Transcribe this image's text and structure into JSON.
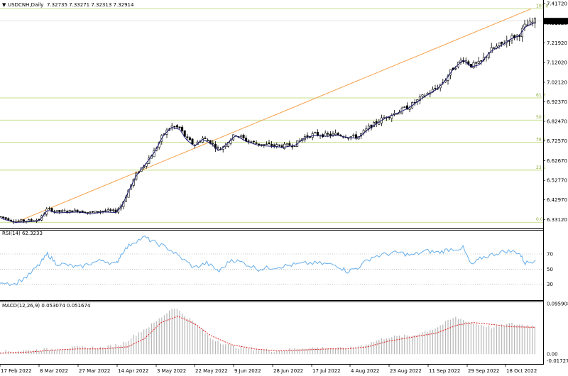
{
  "colors": {
    "candle": "#000000",
    "ma_line": "#1a1a6e",
    "trend_line": "#f5a04a",
    "fib_line": "#b5d46a",
    "rsi_line": "#66aeea",
    "macd_hist": "#b8b8b8",
    "macd_signal": "#e02020",
    "price_tag_bg": "#000000",
    "price_tag_text": "#ffffff"
  },
  "chart_data": [
    {
      "type": "candlestick",
      "panel": "price",
      "header": {
        "symbol": "USDCNH,Daily",
        "ohlc": "7.32735 7.33271 7.32313 7.32914",
        "arrow_icon": "triangle-down-icon"
      },
      "current_price_label": "7.32914",
      "y_ticks": [
        "7.41720",
        "7.31920",
        "7.21920",
        "7.12020",
        "7.02120",
        "6.92370",
        "6.82470",
        "6.72570",
        "6.62670",
        "6.52770",
        "6.42970",
        "6.33120"
      ],
      "ylim": [
        6.3,
        7.4172
      ],
      "x_ticks": [
        "17 Feb 2022",
        "8 Mar 2022",
        "27 Mar 2022",
        "14 Apr 2022",
        "3 May 2022",
        "22 May 2022",
        "9 Jun 2022",
        "28 Jun 2022",
        "17 Jul 2022",
        "4 Aug 2022",
        "23 Aug 2022",
        "11 Sep 2022",
        "29 Sep 2022",
        "18 Oct 2022"
      ],
      "fib_levels": [
        {
          "label": "100.0",
          "value": 7.3905
        },
        {
          "label": "61.8",
          "value": 6.9425
        },
        {
          "label": "50.0",
          "value": 6.831
        },
        {
          "label": "38.2",
          "value": 6.719
        },
        {
          "label": "23.6",
          "value": 6.579
        },
        {
          "label": "0.0",
          "value": 6.317
        }
      ],
      "trend_line": [
        {
          "x": "2022-02-25",
          "y": 6.318
        },
        {
          "x": "2022-11-01",
          "y": 7.391
        }
      ],
      "close_path": [
        [
          "2022-02-17",
          6.345
        ],
        [
          "2022-02-24",
          6.322
        ],
        [
          "2022-03-03",
          6.325
        ],
        [
          "2022-03-08",
          6.33
        ],
        [
          "2022-03-12",
          6.385
        ],
        [
          "2022-03-16",
          6.37
        ],
        [
          "2022-03-22",
          6.372
        ],
        [
          "2022-03-27",
          6.375
        ],
        [
          "2022-04-02",
          6.365
        ],
        [
          "2022-04-08",
          6.375
        ],
        [
          "2022-04-14",
          6.372
        ],
        [
          "2022-04-17",
          6.405
        ],
        [
          "2022-04-20",
          6.475
        ],
        [
          "2022-04-24",
          6.56
        ],
        [
          "2022-04-28",
          6.61
        ],
        [
          "2022-05-03",
          6.68
        ],
        [
          "2022-05-07",
          6.76
        ],
        [
          "2022-05-11",
          6.8
        ],
        [
          "2022-05-15",
          6.79
        ],
        [
          "2022-05-18",
          6.74
        ],
        [
          "2022-05-22",
          6.705
        ],
        [
          "2022-05-26",
          6.74
        ],
        [
          "2022-05-30",
          6.72
        ],
        [
          "2022-06-03",
          6.68
        ],
        [
          "2022-06-07",
          6.72
        ],
        [
          "2022-06-11",
          6.76
        ],
        [
          "2022-06-16",
          6.73
        ],
        [
          "2022-06-22",
          6.71
        ],
        [
          "2022-06-28",
          6.705
        ],
        [
          "2022-07-04",
          6.7
        ],
        [
          "2022-07-10",
          6.71
        ],
        [
          "2022-07-14",
          6.745
        ],
        [
          "2022-07-19",
          6.76
        ],
        [
          "2022-07-25",
          6.755
        ],
        [
          "2022-07-30",
          6.76
        ],
        [
          "2022-08-04",
          6.75
        ],
        [
          "2022-08-09",
          6.745
        ],
        [
          "2022-08-14",
          6.79
        ],
        [
          "2022-08-19",
          6.825
        ],
        [
          "2022-08-23",
          6.85
        ],
        [
          "2022-08-29",
          6.875
        ],
        [
          "2022-09-03",
          6.9
        ],
        [
          "2022-09-07",
          6.93
        ],
        [
          "2022-09-11",
          6.96
        ],
        [
          "2022-09-16",
          6.99
        ],
        [
          "2022-09-20",
          7.03
        ],
        [
          "2022-09-24",
          7.09
        ],
        [
          "2022-09-29",
          7.14
        ],
        [
          "2022-10-03",
          7.105
        ],
        [
          "2022-10-07",
          7.115
        ],
        [
          "2022-10-12",
          7.18
        ],
        [
          "2022-10-18",
          7.215
        ],
        [
          "2022-10-22",
          7.245
        ],
        [
          "2022-10-26",
          7.26
        ],
        [
          "2022-10-29",
          7.305
        ],
        [
          "2022-11-03",
          7.329
        ]
      ]
    },
    {
      "type": "line",
      "panel": "rsi",
      "title": "RSI(14) 62.3233",
      "y_ticks": [
        "70",
        "50",
        "30"
      ],
      "ylim": [
        10,
        100
      ],
      "values": [
        [
          "2022-02-17",
          34
        ],
        [
          "2022-02-24",
          30
        ],
        [
          "2022-03-03",
          42
        ],
        [
          "2022-03-08",
          56
        ],
        [
          "2022-03-12",
          70
        ],
        [
          "2022-03-16",
          58
        ],
        [
          "2022-03-22",
          55
        ],
        [
          "2022-03-27",
          52
        ],
        [
          "2022-04-02",
          58
        ],
        [
          "2022-04-08",
          62
        ],
        [
          "2022-04-14",
          56
        ],
        [
          "2022-04-17",
          72
        ],
        [
          "2022-04-22",
          85
        ],
        [
          "2022-04-28",
          92
        ],
        [
          "2022-05-03",
          85
        ],
        [
          "2022-05-09",
          78
        ],
        [
          "2022-05-15",
          66
        ],
        [
          "2022-05-22",
          52
        ],
        [
          "2022-05-28",
          58
        ],
        [
          "2022-06-03",
          47
        ],
        [
          "2022-06-09",
          63
        ],
        [
          "2022-06-15",
          58
        ],
        [
          "2022-06-22",
          50
        ],
        [
          "2022-06-28",
          52
        ],
        [
          "2022-07-04",
          54
        ],
        [
          "2022-07-10",
          56
        ],
        [
          "2022-07-17",
          58
        ],
        [
          "2022-07-24",
          57
        ],
        [
          "2022-07-30",
          55
        ],
        [
          "2022-08-04",
          47
        ],
        [
          "2022-08-09",
          52
        ],
        [
          "2022-08-16",
          66
        ],
        [
          "2022-08-23",
          70
        ],
        [
          "2022-08-29",
          72
        ],
        [
          "2022-09-04",
          68
        ],
        [
          "2022-09-11",
          74
        ],
        [
          "2022-09-17",
          72
        ],
        [
          "2022-09-22",
          76
        ],
        [
          "2022-09-29",
          78
        ],
        [
          "2022-10-03",
          55
        ],
        [
          "2022-10-08",
          65
        ],
        [
          "2022-10-14",
          70
        ],
        [
          "2022-10-20",
          74
        ],
        [
          "2022-10-26",
          72
        ],
        [
          "2022-10-29",
          58
        ],
        [
          "2022-11-03",
          62
        ]
      ]
    },
    {
      "type": "bar",
      "panel": "macd",
      "title": "MACD(12,26,9) 0.053074 0.051674",
      "y_ticks": [
        "0.095908",
        "0.00",
        "-0.017276"
      ],
      "ylim": [
        -0.017276,
        0.095908
      ],
      "histogram": [
        [
          "2022-02-17",
          0.005
        ],
        [
          "2022-03-03",
          0.007
        ],
        [
          "2022-03-16",
          0.01
        ],
        [
          "2022-03-27",
          0.013
        ],
        [
          "2022-04-08",
          0.012
        ],
        [
          "2022-04-17",
          0.02
        ],
        [
          "2022-04-24",
          0.038
        ],
        [
          "2022-05-03",
          0.06
        ],
        [
          "2022-05-12",
          0.09
        ],
        [
          "2022-05-22",
          0.06
        ],
        [
          "2022-05-30",
          0.03
        ],
        [
          "2022-06-09",
          0.015
        ],
        [
          "2022-06-20",
          0.01
        ],
        [
          "2022-07-01",
          0.006
        ],
        [
          "2022-07-14",
          0.012
        ],
        [
          "2022-07-26",
          0.012
        ],
        [
          "2022-08-04",
          0.01
        ],
        [
          "2022-08-14",
          0.02
        ],
        [
          "2022-08-23",
          0.032
        ],
        [
          "2022-09-04",
          0.035
        ],
        [
          "2022-09-16",
          0.05
        ],
        [
          "2022-09-25",
          0.07
        ],
        [
          "2022-10-03",
          0.06
        ],
        [
          "2022-10-14",
          0.05
        ],
        [
          "2022-10-22",
          0.058
        ],
        [
          "2022-11-03",
          0.053
        ]
      ],
      "signal": [
        [
          "2022-02-17",
          0.002
        ],
        [
          "2022-03-03",
          0.004
        ],
        [
          "2022-03-16",
          0.008
        ],
        [
          "2022-03-27",
          0.01
        ],
        [
          "2022-04-08",
          0.01
        ],
        [
          "2022-04-20",
          0.014
        ],
        [
          "2022-04-28",
          0.03
        ],
        [
          "2022-05-06",
          0.06
        ],
        [
          "2022-05-14",
          0.072
        ],
        [
          "2022-05-22",
          0.058
        ],
        [
          "2022-05-30",
          0.035
        ],
        [
          "2022-06-09",
          0.018
        ],
        [
          "2022-06-20",
          0.01
        ],
        [
          "2022-07-01",
          0.006
        ],
        [
          "2022-07-14",
          0.008
        ],
        [
          "2022-07-26",
          0.01
        ],
        [
          "2022-08-04",
          0.01
        ],
        [
          "2022-08-14",
          0.014
        ],
        [
          "2022-08-23",
          0.024
        ],
        [
          "2022-09-04",
          0.032
        ],
        [
          "2022-09-16",
          0.04
        ],
        [
          "2022-09-26",
          0.055
        ],
        [
          "2022-10-04",
          0.06
        ],
        [
          "2022-10-14",
          0.056
        ],
        [
          "2022-10-22",
          0.052
        ],
        [
          "2022-11-03",
          0.051
        ]
      ]
    }
  ]
}
